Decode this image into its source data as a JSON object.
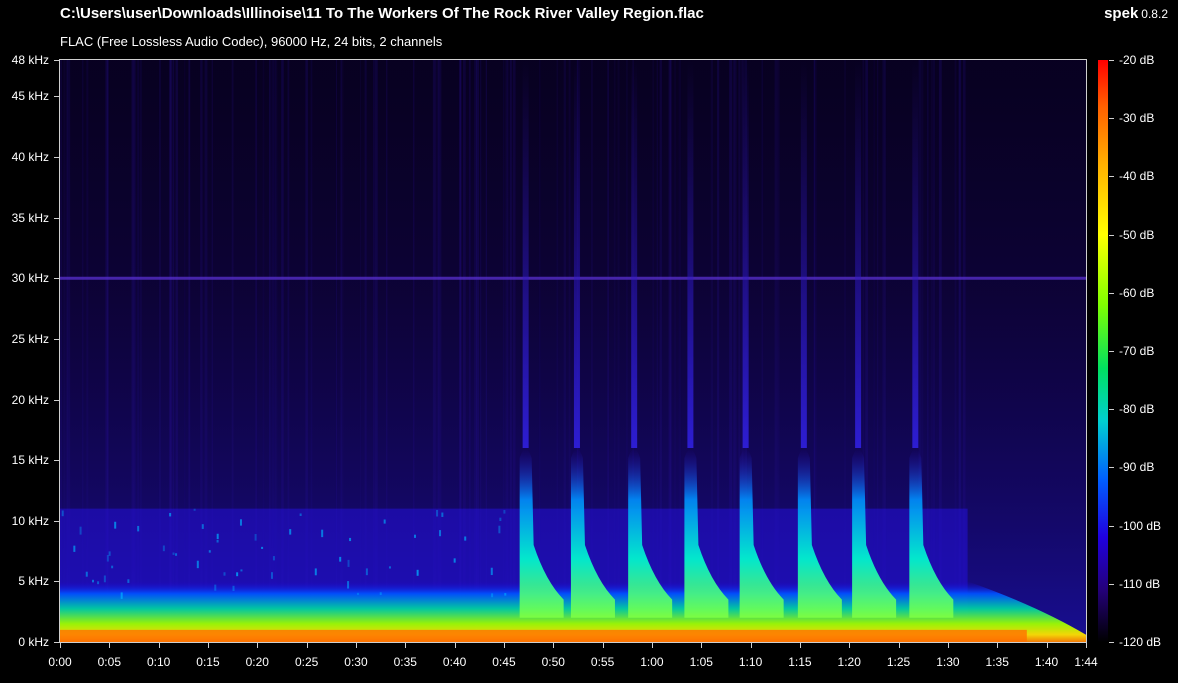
{
  "header": {
    "file_path": "C:\\Users\\user\\Downloads\\Illinoise\\11 To The Workers Of The Rock River Valley Region.flac",
    "file_info": "FLAC (Free Lossless Audio Codec), 96000 Hz, 24 bits, 2 channels",
    "app_name": "spek",
    "app_version": "0.8.2"
  },
  "chart_data": {
    "type": "heatmap",
    "x_axis": {
      "unit": "time",
      "range_seconds": [
        0,
        104
      ],
      "tick_labels": [
        "0:00",
        "0:05",
        "0:10",
        "0:15",
        "0:20",
        "0:25",
        "0:30",
        "0:35",
        "0:40",
        "0:45",
        "0:50",
        "0:55",
        "1:00",
        "1:05",
        "1:10",
        "1:15",
        "1:20",
        "1:25",
        "1:30",
        "1:35",
        "1:40",
        "1:44"
      ]
    },
    "y_axis": {
      "unit": "kHz",
      "range": [
        0,
        48
      ],
      "tick_labels": [
        "0 kHz",
        "5 kHz",
        "10 kHz",
        "15 kHz",
        "20 kHz",
        "25 kHz",
        "30 kHz",
        "35 kHz",
        "40 kHz",
        "45 kHz",
        "48 kHz"
      ]
    },
    "color_scale": {
      "unit": "dB",
      "range": [
        -120,
        -20
      ],
      "tick_labels": [
        "-20 dB",
        "-30 dB",
        "-40 dB",
        "-50 dB",
        "-60 dB",
        "-70 dB",
        "-80 dB",
        "-90 dB",
        "-100 dB",
        "-110 dB",
        "-120 dB"
      ],
      "colors_high_to_low": [
        "#ff0000",
        "#ff8000",
        "#ffff00",
        "#80ff00",
        "#00d0d0",
        "#0060ff",
        "#2000e0",
        "#24007a",
        "#000000"
      ]
    },
    "features": {
      "persistent_tone_khz": 30,
      "transient_peak_seconds": [
        47.2,
        52.4,
        58.2,
        63.9,
        69.5,
        75.4,
        80.9,
        86.7
      ],
      "transient_peak_max_khz": 16,
      "fade_out_start_seconds": 92
    }
  }
}
